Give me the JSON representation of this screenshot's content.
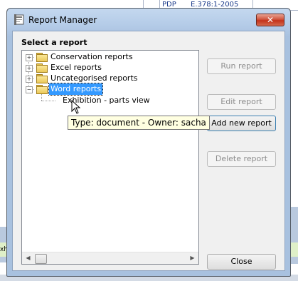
{
  "background": {
    "grid_cell_1": "PDP",
    "grid_cell_2": "E.378:1-2005",
    "left_fragment": "xhibi"
  },
  "dialog": {
    "title": "Report Manager",
    "close_glyph": "✕",
    "section_label": "Select a report",
    "tree": {
      "folders": [
        {
          "label": "Conservation reports",
          "expanded": false
        },
        {
          "label": "Excel reports",
          "expanded": false
        },
        {
          "label": "Uncategorised reports",
          "expanded": false
        },
        {
          "label": "Word reports",
          "expanded": true,
          "selected": true
        }
      ],
      "child_item": "Exhibition - parts view"
    },
    "buttons": {
      "run": "Run report",
      "edit": "Edit report",
      "add": "Add new report",
      "delete": "Delete report",
      "close": "Close"
    },
    "tooltip": "Type: document - Owner: sacha"
  },
  "icons": {
    "app": "report-manager-icon",
    "folder": "folder-icon",
    "expander_collapsed": "plus-box-icon",
    "expander_expanded": "minus-box-icon",
    "close": "close-icon",
    "cursor": "mouse-pointer-icon"
  },
  "colors": {
    "selection": "#3399ff",
    "titlebar": "#b5cce8",
    "close_button": "#c4321a",
    "tooltip_bg": "#ffffe1"
  }
}
